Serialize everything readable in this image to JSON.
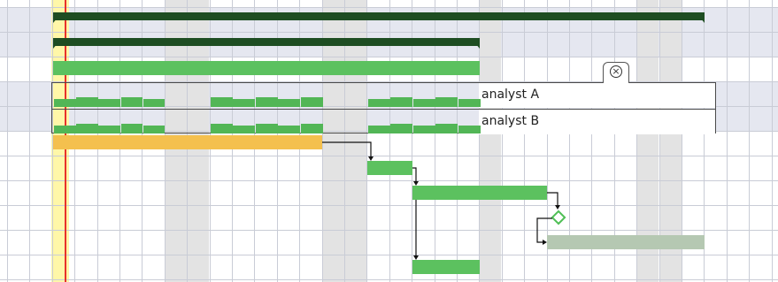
{
  "chart": {
    "today_column_color": "#fff7a8",
    "today_line_color": "#e8322c",
    "summary_color": "#1e4d22",
    "task_color": "#5cc15f",
    "critical_task_color": "#f4c04e",
    "ghost_task_color": "#b5c8b2",
    "grid_color": "#c9ccd6"
  },
  "resource_popup": {
    "rows": [
      {
        "label": "analyst A"
      },
      {
        "label": "analyst B"
      }
    ],
    "close_icon": "close-circle-icon",
    "close_glyph": "×"
  }
}
